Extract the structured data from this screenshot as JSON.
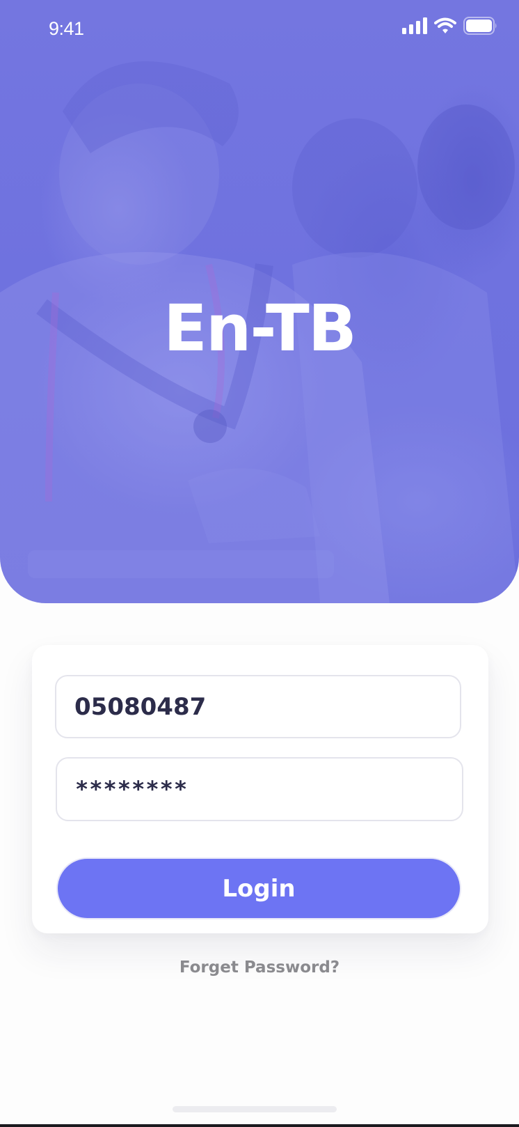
{
  "status_bar": {
    "time": "9:41",
    "icons": [
      "cellular-signal-icon",
      "wifi-icon",
      "battery-icon"
    ]
  },
  "hero": {
    "app_title": "En-TB",
    "overlay_color": "#6f72df"
  },
  "login_form": {
    "phone_value": "05080487",
    "password_value": "********",
    "login_label": "Login",
    "forgot_password_label": "Forget Password?"
  },
  "colors": {
    "primary": "#6d74f3",
    "text_dark": "#2c2c4a",
    "muted": "#8a8a8e"
  }
}
